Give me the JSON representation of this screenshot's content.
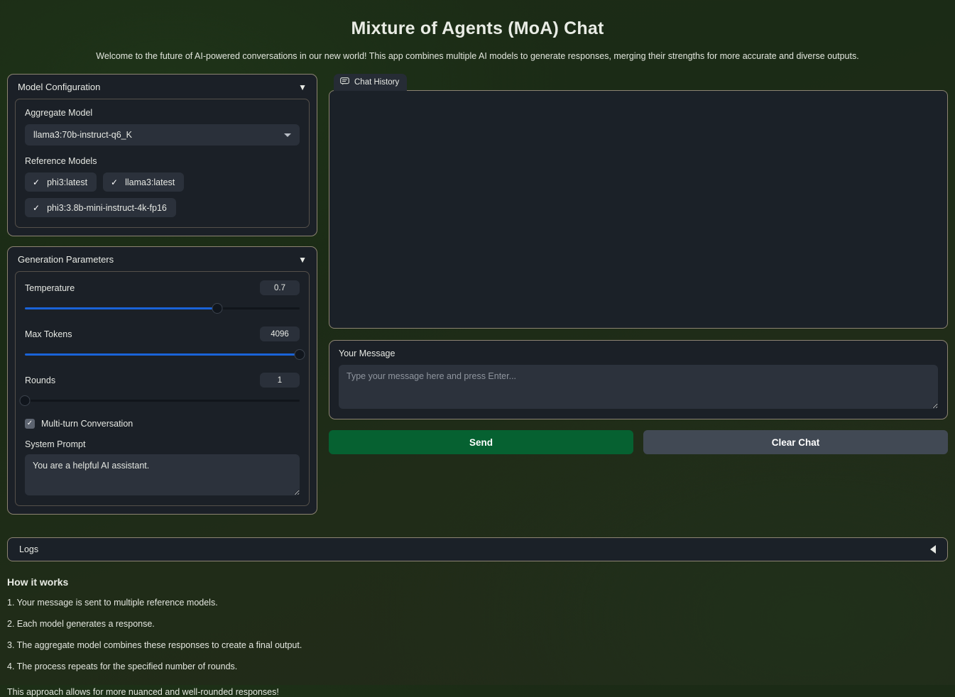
{
  "header": {
    "title": "Mixture of Agents (MoA) Chat",
    "subtitle": "Welcome to the future of AI-powered conversations in our new world! This app combines multiple AI models to generate responses, merging their strengths for more accurate and diverse outputs."
  },
  "model_config": {
    "title": "Model Configuration",
    "collapse_icon": "▼",
    "aggregate_label": "Aggregate Model",
    "aggregate_value": "llama3:70b-instruct-q6_K",
    "reference_label": "Reference Models",
    "reference_models": [
      {
        "label": "phi3:latest",
        "checked": true,
        "tick": "✓"
      },
      {
        "label": "llama3:latest",
        "checked": true,
        "tick": "✓"
      },
      {
        "label": "phi3:3.8b-mini-instruct-4k-fp16",
        "checked": true,
        "tick": "✓"
      }
    ]
  },
  "generation": {
    "title": "Generation Parameters",
    "collapse_icon": "▼",
    "temperature": {
      "label": "Temperature",
      "value": "0.7",
      "percent": 70
    },
    "max_tokens": {
      "label": "Max Tokens",
      "value": "4096",
      "percent": 100
    },
    "rounds": {
      "label": "Rounds",
      "value": "1",
      "percent": 0
    },
    "multiturn": {
      "label": "Multi-turn Conversation",
      "checked": true,
      "tick": "✓"
    },
    "system_prompt": {
      "label": "System Prompt",
      "value": "You are a helpful AI assistant."
    }
  },
  "chat": {
    "tab_label": "Chat History",
    "tab_icon": "chat-bubble-icon",
    "history": ""
  },
  "message": {
    "label": "Your Message",
    "value": "",
    "placeholder": "Type your message here and press Enter..."
  },
  "actions": {
    "send_label": "Send",
    "clear_label": "Clear Chat",
    "send_color": "#066131",
    "clear_color": "#414954"
  },
  "logs": {
    "label": "Logs",
    "collapse_icon": "◀"
  },
  "how_it_works": {
    "title": "How it works",
    "steps": [
      "1. Your message is sent to multiple reference models.",
      "2. Each model generates a response.",
      "3. The aggregate model combines these responses to create a final output.",
      "4. The process repeats for the specified number of rounds."
    ],
    "closing": "This approach allows for more nuanced and well-rounded responses!"
  },
  "theme": {
    "accent_slider": "#1a63d8",
    "panel_border": "#8c8372",
    "panel_bg": "#1b2027"
  }
}
